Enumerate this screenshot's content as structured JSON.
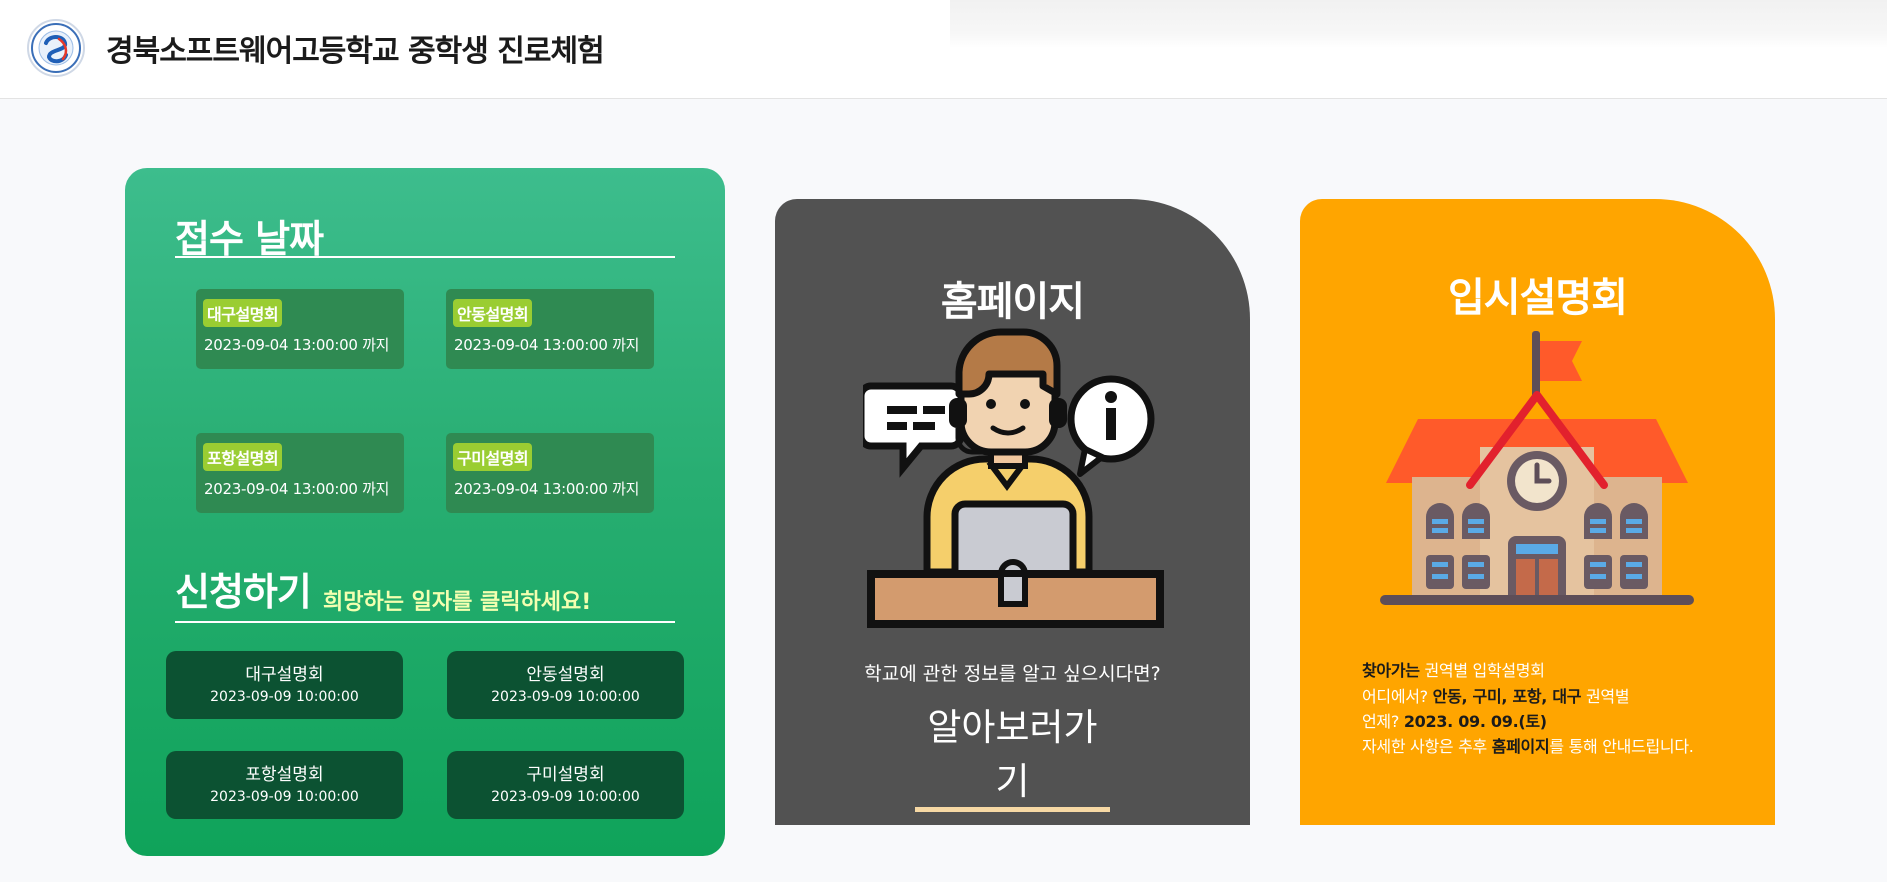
{
  "header": {
    "title": "경북소프트웨어고등학교 중학생 진로체험",
    "logo_icon": "school-emblem-icon"
  },
  "registration": {
    "title": "접수 날짜",
    "items": [
      {
        "label": "대구설명회",
        "deadline": "2023-09-04 13:00:00 까지"
      },
      {
        "label": "안동설명회",
        "deadline": "2023-09-04 13:00:00 까지"
      },
      {
        "label": "포항설명회",
        "deadline": "2023-09-04 13:00:00 까지"
      },
      {
        "label": "구미설명회",
        "deadline": "2023-09-04 13:00:00 까지"
      }
    ]
  },
  "apply": {
    "title": "신청하기",
    "subtitle": "희망하는 일자를 클릭하세요!",
    "buttons": [
      {
        "label": "대구설명회",
        "datetime": "2023-09-09 10:00:00"
      },
      {
        "label": "안동설명회",
        "datetime": "2023-09-09 10:00:00"
      },
      {
        "label": "포항설명회",
        "datetime": "2023-09-09 10:00:00"
      },
      {
        "label": "구미설명회",
        "datetime": "2023-09-09 10:00:00"
      }
    ]
  },
  "homepage_card": {
    "title": "홈페이지",
    "question": "학교에 관한 정보를 알고 싶으시다면?",
    "link_label": "알아보러가기",
    "icon": "customer-support-icon"
  },
  "admission_card": {
    "title": "입시설명회",
    "icon": "school-building-icon",
    "line1": {
      "bold": "찾아가는",
      "rest": " 권역별 입학설명회"
    },
    "line2": {
      "pre": "어디에서? ",
      "bold": "안동, 구미, 포항, 대구",
      "rest": " 권역별"
    },
    "line3": {
      "pre": "언제? ",
      "bold": "2023. 09. 09.(토)"
    },
    "line4": {
      "pre": "자세한 사항은 추후 ",
      "bold": "홈페이지",
      "rest": "를 통해 안내드립니다."
    }
  },
  "colors": {
    "green_top": "#3dbd8d",
    "green_bottom": "#0fa35a",
    "badge": "#9acd32",
    "apply_button": "#0c5232",
    "dark_card": "#525252",
    "orange_card": "#ffa500",
    "link_underline": "#f6d8a4"
  }
}
